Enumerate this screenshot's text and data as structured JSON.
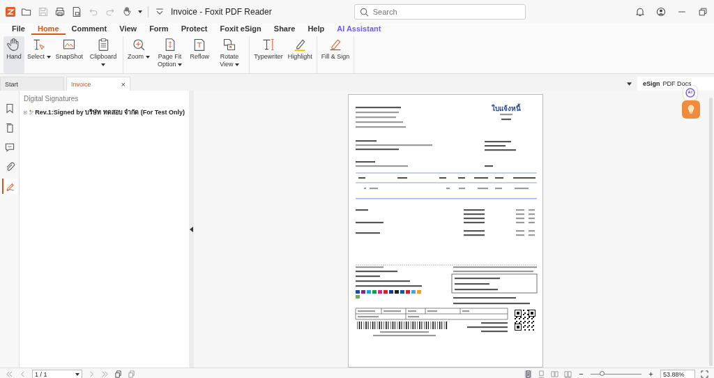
{
  "window": {
    "title": "Invoice - Foxit PDF Reader"
  },
  "quick_access": [
    {
      "disabled": false
    },
    {
      "disabled": true
    },
    {
      "disabled": false
    },
    {
      "disabled": false
    },
    {
      "disabled": true
    },
    {
      "disabled": true
    },
    {
      "disabled": false
    }
  ],
  "search": {
    "placeholder": "Search"
  },
  "menu": [
    {
      "label": "File",
      "selected": false
    },
    {
      "label": "Home",
      "selected": true
    },
    {
      "label": "Comment",
      "selected": false
    },
    {
      "label": "View",
      "selected": false
    },
    {
      "label": "Form",
      "selected": false
    },
    {
      "label": "Protect",
      "selected": false
    },
    {
      "label": "Foxit eSign",
      "selected": false
    },
    {
      "label": "Share",
      "selected": false
    },
    {
      "label": "Help",
      "selected": false
    },
    {
      "label": "AI Assistant",
      "selected": false,
      "kind": "ai"
    }
  ],
  "ribbon": [
    [
      {
        "label": "Hand",
        "selected": true,
        "dropdown": false
      },
      {
        "label": "Select",
        "selected": false,
        "dropdown": true
      },
      {
        "label": "SnapShot",
        "selected": false,
        "dropdown": false
      },
      {
        "label": "Clipboard",
        "selected": false,
        "dropdown": true
      }
    ],
    [
      {
        "label": "Zoom",
        "selected": false,
        "dropdown": true
      },
      {
        "label": "Page Fit Option",
        "selected": false,
        "dropdown": true
      },
      {
        "label": "Reflow",
        "selected": false,
        "dropdown": false
      },
      {
        "label": "Rotate View",
        "selected": false,
        "dropdown": true
      }
    ],
    [
      {
        "label": "Typewriter",
        "selected": false,
        "dropdown": false
      },
      {
        "label": "Highlight",
        "selected": false,
        "dropdown": false
      }
    ],
    [
      {
        "label": "Fill & Sign",
        "selected": false,
        "dropdown": false
      }
    ]
  ],
  "doc_tabs": [
    {
      "label": "Start",
      "selected": false
    },
    {
      "label": "Invoice",
      "selected": true,
      "close": "×"
    }
  ],
  "banner": {
    "brand": "eSign",
    "text": "PDF Docs"
  },
  "side_tools": [
    {
      "selected": false
    },
    {
      "selected": false
    },
    {
      "selected": false
    },
    {
      "selected": false
    },
    {
      "selected": true
    }
  ],
  "panel": {
    "title": "Digital Signatures",
    "items": [
      {
        "expanded": false,
        "label": "Rev.1:Signed by บริษัท ทดสอบ จำกัด (For Test Only)"
      }
    ]
  },
  "document": {
    "title": "ใบแจ้งหนี้"
  },
  "status": {
    "page": "1 / 1",
    "zoom": "53.88%",
    "zoom_slider": {
      "level": 0.22
    }
  }
}
